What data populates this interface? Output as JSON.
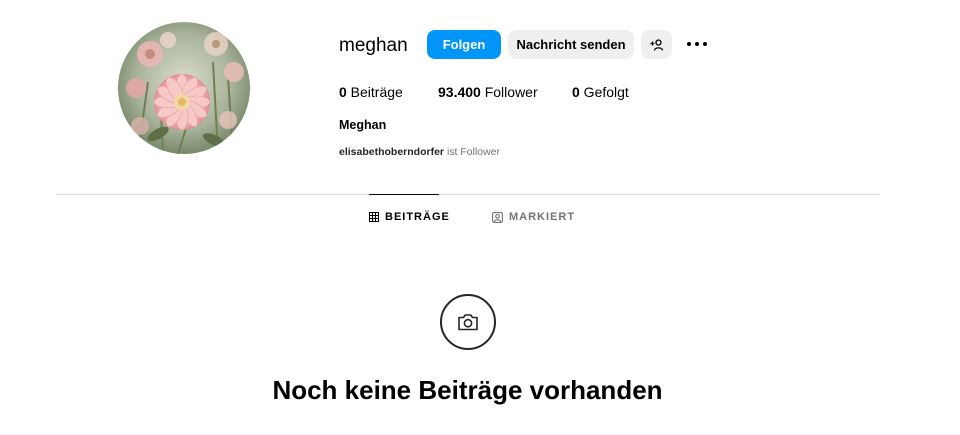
{
  "profile": {
    "username": "meghan",
    "full_name": "Meghan",
    "avatar_desc": "pink-dahlia-flowers",
    "followed_by_user": "elisabethoberndorfer",
    "followed_by_suffix": " ist Follower"
  },
  "actions": {
    "follow_label": "Folgen",
    "message_label": "Nachricht senden",
    "add_user_icon": "add-person-icon",
    "more_icon": "more-horizontal-icon"
  },
  "stats": {
    "posts_count": "0",
    "posts_label": " Beiträge",
    "followers_count": "93.400",
    "followers_label": " Follower",
    "following_count": "0",
    "following_label": " Gefolgt"
  },
  "tabs": [
    {
      "label": "BEITRÄGE",
      "icon": "grid-icon",
      "active": true
    },
    {
      "label": "MARKIERT",
      "icon": "tagged-user-icon",
      "active": false
    }
  ],
  "empty_state": {
    "icon": "camera-icon",
    "title": "Noch keine Beiträge vorhanden"
  },
  "colors": {
    "primary_button": "#0095f6",
    "secondary_button": "#efefef",
    "divider": "#dbdbdb",
    "muted_text": "#737373"
  }
}
